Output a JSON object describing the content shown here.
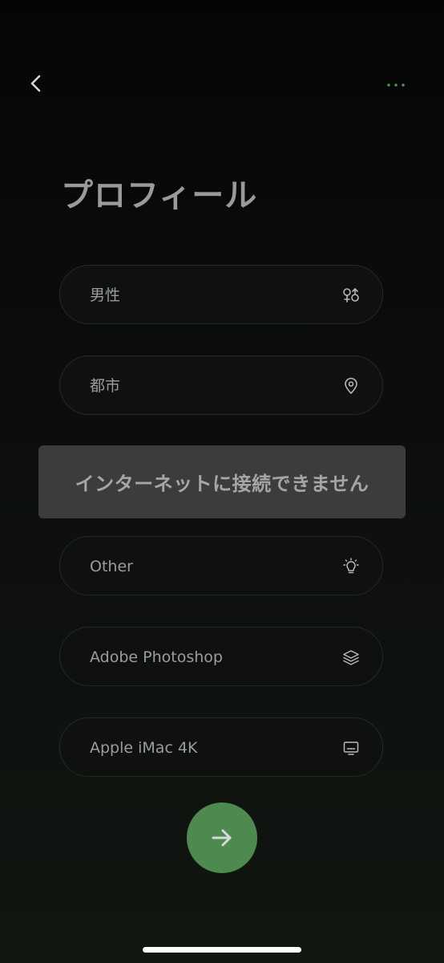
{
  "header": {
    "back_icon": "chevron-left-icon",
    "more_icon": "more-dots-icon"
  },
  "page": {
    "title": "プロフィール"
  },
  "fields": [
    {
      "value": "男性",
      "icon": "gender-icon"
    },
    {
      "value": "都市",
      "icon": "location-pin-icon"
    },
    {
      "value": "Other",
      "icon": "lightbulb-icon"
    },
    {
      "value": "Adobe Photoshop",
      "icon": "layers-icon"
    },
    {
      "value": "Apple iMac 4K",
      "icon": "monitor-icon"
    }
  ],
  "toast": {
    "message": "インターネットに接続できません"
  },
  "next_button": {
    "icon": "arrow-right-icon"
  },
  "colors": {
    "accent": "#4d8a50",
    "dots": "#4f9a48",
    "background": "#0b0d0b",
    "field_border": "#262a26",
    "toast_background": "#3c3c3c"
  }
}
